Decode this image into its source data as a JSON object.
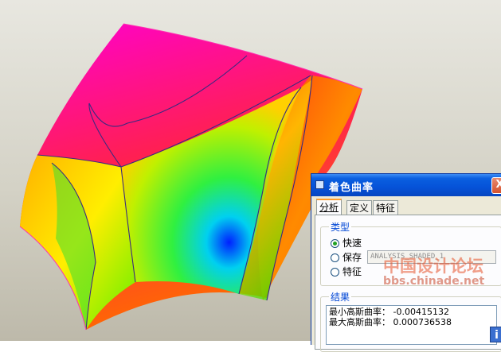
{
  "dialog": {
    "title": "着色曲率",
    "close_label": "X",
    "tabs": [
      {
        "label": "分析"
      },
      {
        "label": "定义"
      },
      {
        "label": "特征"
      }
    ],
    "type_group": {
      "label": "类型",
      "options": [
        {
          "label": "快速",
          "checked": true
        },
        {
          "label": "保存",
          "checked": false
        },
        {
          "label": "特征",
          "checked": false
        }
      ],
      "save_name": "ANALYSIS_SHADED_1"
    },
    "result_group": {
      "label": "结果",
      "lines": [
        "最小高斯曲率： -0.00415132",
        "最大高斯曲率： 0.000736538"
      ]
    },
    "watermark": "中国设计论坛",
    "watermark_url": "bbs.chinade.net",
    "info_label": "i"
  },
  "colors": {
    "title_bar": "#0552d8",
    "dialog_bg": "#ece9d8",
    "group_label": "#0046d5",
    "surface_high": "#ff00cc",
    "surface_low": "#0000ff"
  }
}
